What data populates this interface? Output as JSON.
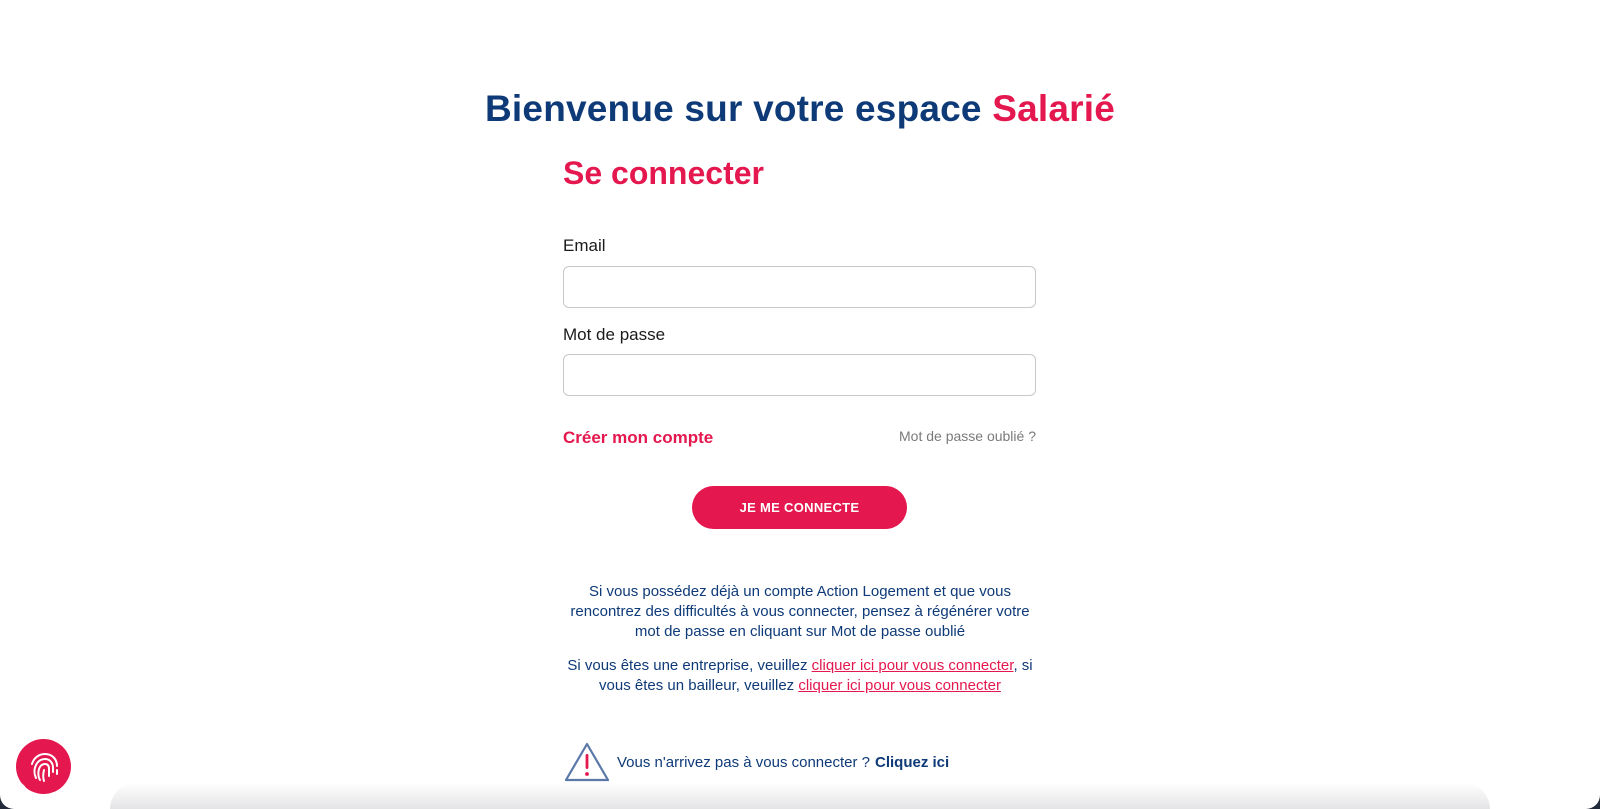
{
  "header": {
    "title_main": "Bienvenue sur votre espace ",
    "title_accent": "Salarié"
  },
  "login": {
    "heading": "Se connecter",
    "email_label": "Email",
    "email_value": "",
    "password_label": "Mot de passe",
    "password_value": "",
    "create_account_link": "Créer mon compte",
    "forgot_password_link": "Mot de passe oublié ?",
    "submit_label": "JE ME CONNECTE"
  },
  "info": {
    "paragraph1": "Si vous possédez déjà un compte Action Logement et que vous rencontrez des difficultés à vous connecter, pensez à régénérer votre mot de passe en cliquant sur Mot de passe oublié",
    "paragraph2_text_a": "Si vous êtes une entreprise, veuillez ",
    "company_link": "cliquer ici pour vous connecter",
    "paragraph2_text_b": ", si vous êtes un bailleur, veuillez ",
    "landlord_link": "cliquer ici pour vous connecter"
  },
  "help": {
    "question": "Vous n'arrivez pas à vous connecter ?",
    "cta": "Cliquez ici",
    "icon": "warning-triangle-icon"
  },
  "fab": {
    "icon": "fingerprint-icon"
  },
  "colors": {
    "navy": "#0e3a78",
    "accent": "#e4174e",
    "muted": "#7a7a7a"
  }
}
